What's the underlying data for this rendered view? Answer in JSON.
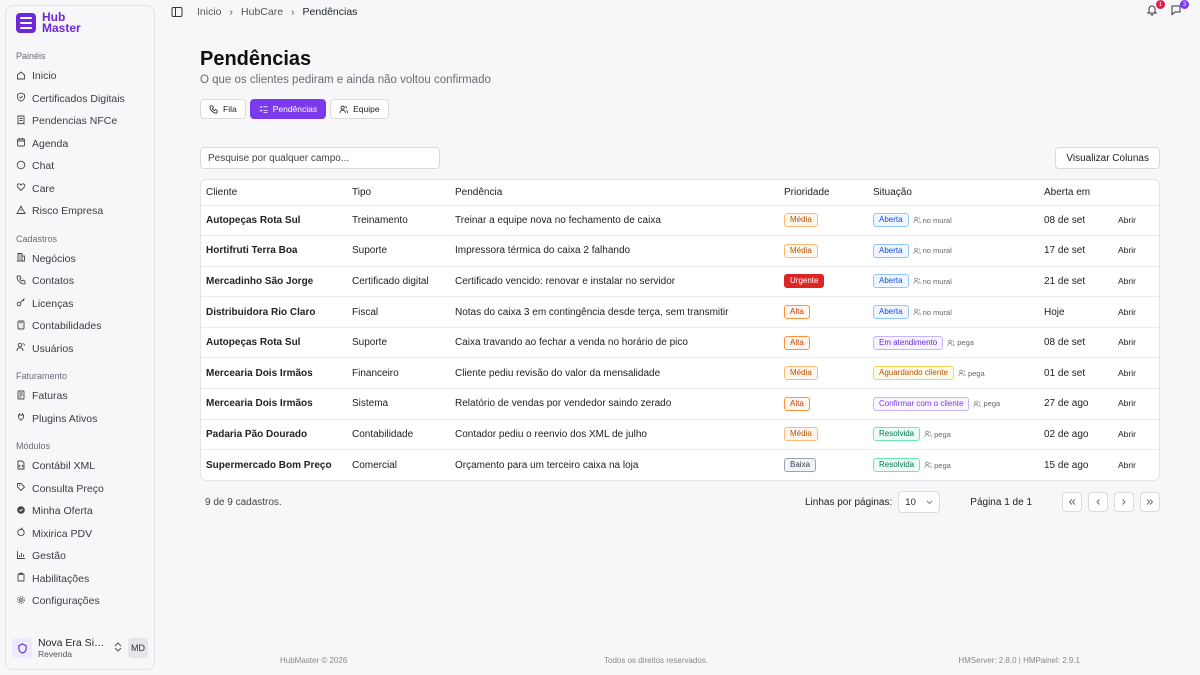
{
  "app": {
    "logo_line1": "Hub",
    "logo_line2": "Master",
    "brand_color": "#6d28d9"
  },
  "sidebar": {
    "sections": [
      {
        "title": "Painéis",
        "items": [
          {
            "label": "Inicio",
            "icon": "home-icon"
          },
          {
            "label": "Certificados Digitais",
            "icon": "shield-check-icon"
          },
          {
            "label": "Pendencias NFCe",
            "icon": "receipt-icon"
          },
          {
            "label": "Agenda",
            "icon": "calendar-icon"
          },
          {
            "label": "Chat",
            "icon": "chat-icon"
          },
          {
            "label": "Care",
            "icon": "heart-icon"
          },
          {
            "label": "Risco Empresa",
            "icon": "alert-triangle-icon"
          }
        ]
      },
      {
        "title": "Cadastros",
        "items": [
          {
            "label": "Negócios",
            "icon": "building-icon"
          },
          {
            "label": "Contatos",
            "icon": "phone-icon"
          },
          {
            "label": "Licenças",
            "icon": "key-icon"
          },
          {
            "label": "Contabilidades",
            "icon": "calculator-icon"
          },
          {
            "label": "Usuários",
            "icon": "users-icon"
          }
        ]
      },
      {
        "title": "Faturamento",
        "items": [
          {
            "label": "Faturas",
            "icon": "invoice-icon"
          },
          {
            "label": "Plugins Ativos",
            "icon": "plug-icon"
          }
        ]
      },
      {
        "title": "Módulos",
        "items": [
          {
            "label": "Contábil XML",
            "icon": "file-code-icon"
          },
          {
            "label": "Consulta Preço",
            "icon": "tag-icon"
          },
          {
            "label": "Minha Oferta",
            "icon": "badge-icon"
          },
          {
            "label": "Mixirica PDV",
            "icon": "citrus-icon"
          },
          {
            "label": "Gestão",
            "icon": "bar-chart-icon"
          },
          {
            "label": "Habilitações",
            "icon": "clipboard-icon"
          },
          {
            "label": "Configurações",
            "icon": "gear-icon"
          }
        ]
      }
    ],
    "org": {
      "name": "Nova Era Siste...",
      "role": "Revenda",
      "avatar": "MD"
    }
  },
  "topbar": {
    "breadcrumbs": [
      "Inicio",
      "HubCare",
      "Pendências"
    ],
    "notifications": [
      {
        "icon": "bell-icon",
        "count": "1",
        "color": "#e11d48"
      },
      {
        "icon": "message-icon",
        "count": "3",
        "color": "#7c3aed"
      }
    ]
  },
  "page": {
    "title": "Pendências",
    "subtitle": "O que os clientes pediram e ainda não voltou confirmado",
    "tabs": [
      {
        "label": "Fila",
        "icon": "phone-icon",
        "active": false
      },
      {
        "label": "Pendências",
        "icon": "list-checks-icon",
        "active": true
      },
      {
        "label": "Equipe",
        "icon": "users-icon",
        "active": false
      }
    ],
    "search_placeholder": "Pesquise por qualquer campo...",
    "columns_button": "Visualizar Colunas"
  },
  "table": {
    "headers": [
      "Cliente",
      "Tipo",
      "Pendência",
      "Prioridade",
      "Situação",
      "Aberta em",
      ""
    ],
    "rows": [
      {
        "cliente": "Autopeças Rota Sul",
        "tipo": "Treinamento",
        "pendencia": "Treinar a equipe nova no fechamento de caixa",
        "prioridade": "Média",
        "situacao": "Aberta",
        "responsavel": "no mural",
        "aberta": "08 de set",
        "acao": "Abrir"
      },
      {
        "cliente": "Hortifruti Terra Boa",
        "tipo": "Suporte",
        "pendencia": "Impressora térmica do caixa 2 falhando",
        "prioridade": "Média",
        "situacao": "Aberta",
        "responsavel": "no mural",
        "aberta": "17 de set",
        "acao": "Abrir"
      },
      {
        "cliente": "Mercadinho São Jorge",
        "tipo": "Certificado digital",
        "pendencia": "Certificado vencido: renovar e instalar no servidor",
        "prioridade": "Urgente",
        "situacao": "Aberta",
        "responsavel": "no mural",
        "aberta": "21 de set",
        "acao": "Abrir"
      },
      {
        "cliente": "Distribuidora Rio Claro",
        "tipo": "Fiscal",
        "pendencia": "Notas do caixa 3 em contingência desde terça, sem transmitir",
        "prioridade": "Alta",
        "situacao": "Aberta",
        "responsavel": "no mural",
        "aberta": "Hoje",
        "acao": "Abrir"
      },
      {
        "cliente": "Autopeças Rota Sul",
        "tipo": "Suporte",
        "pendencia": "Caixa travando ao fechar a venda no horário de pico",
        "prioridade": "Alta",
        "situacao": "Em atendimento",
        "responsavel": "pega",
        "aberta": "08 de set",
        "acao": "Abrir"
      },
      {
        "cliente": "Mercearia Dois Irmãos",
        "tipo": "Financeiro",
        "pendencia": "Cliente pediu revisão do valor da mensalidade",
        "prioridade": "Média",
        "situacao": "Aguardando cliente",
        "responsavel": "pega",
        "aberta": "01 de set",
        "acao": "Abrir"
      },
      {
        "cliente": "Mercearia Dois Irmãos",
        "tipo": "Sistema",
        "pendencia": "Relatório de vendas por vendedor saindo zerado",
        "prioridade": "Alta",
        "situacao": "Confirmar com o cliente",
        "responsavel": "pega",
        "aberta": "27 de ago",
        "acao": "Abrir"
      },
      {
        "cliente": "Padaria Pão Dourado",
        "tipo": "Contabilidade",
        "pendencia": "Contador pediu o reenvio dos XML de julho",
        "prioridade": "Média",
        "situacao": "Resolvida",
        "responsavel": "pega",
        "aberta": "02 de ago",
        "acao": "Abrir"
      },
      {
        "cliente": "Supermercado Bom Preço",
        "tipo": "Comercial",
        "pendencia": "Orçamento para um terceiro caixa na loja",
        "prioridade": "Baixa",
        "situacao": "Resolvida",
        "responsavel": "pega",
        "aberta": "15 de ago",
        "acao": "Abrir"
      }
    ]
  },
  "priority_styles": {
    "Média": {
      "color": "#b45309",
      "bg": "#fff7ed",
      "border": "#fdba74"
    },
    "Alta": {
      "color": "#c2410c",
      "bg": "#fff7ed",
      "border": "#fb923c"
    },
    "Urgente": {
      "color": "#ffffff",
      "bg": "#dc2626",
      "border": "#dc2626"
    },
    "Baixa": {
      "color": "#374151",
      "bg": "#f3f4f6",
      "border": "#9ca3af"
    }
  },
  "status_styles": {
    "Aberta": {
      "color": "#1d4ed8",
      "bg": "#eff6ff",
      "border": "#93c5fd"
    },
    "Em atendimento": {
      "color": "#6d28d9",
      "bg": "#f5f3ff",
      "border": "#c4b5fd"
    },
    "Aguardando cliente": {
      "color": "#b45309",
      "bg": "#fffbeb",
      "border": "#fcd34d"
    },
    "Confirmar com o cliente": {
      "color": "#7c3aed",
      "bg": "#faf5ff",
      "border": "#c4b5fd"
    },
    "Resolvida": {
      "color": "#047857",
      "bg": "#ecfdf5",
      "border": "#6ee7b7"
    }
  },
  "pagination": {
    "count_text": "9 de 9 cadastros.",
    "rows_label": "Linhas por páginas:",
    "rows_value": "10",
    "page_label": "Página 1 de 1"
  },
  "footer": {
    "left": "HubMaster © 2026",
    "middle": "Todos os direitos reservados.",
    "right": "HMServer: 2.8.0 | HMPainel: 2.9.1"
  }
}
